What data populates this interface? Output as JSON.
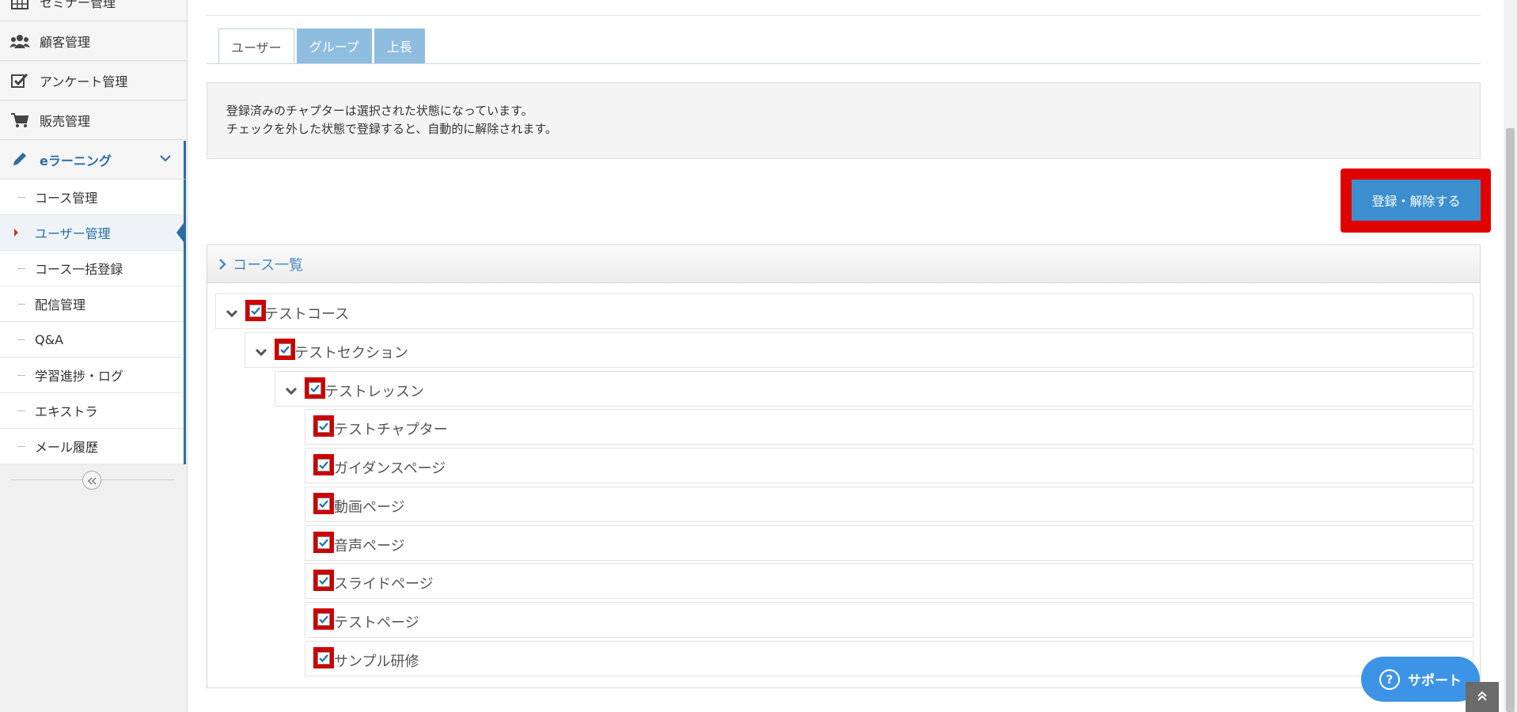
{
  "sidebar": {
    "items": [
      {
        "label": "セミナー管理",
        "icon": "calendar-grid-icon"
      },
      {
        "label": "顧客管理",
        "icon": "users-icon"
      },
      {
        "label": "アンケート管理",
        "icon": "checkbox-icon"
      },
      {
        "label": "販売管理",
        "icon": "cart-icon"
      },
      {
        "label": "eラーニング",
        "icon": "pencil-icon"
      }
    ],
    "submenu": [
      {
        "label": "コース管理"
      },
      {
        "label": "ユーザー管理"
      },
      {
        "label": "コース一括登録"
      },
      {
        "label": "配信管理"
      },
      {
        "label": "Q&A"
      },
      {
        "label": "学習進捗・ログ"
      },
      {
        "label": "エキストラ"
      },
      {
        "label": "メール履歴"
      }
    ]
  },
  "tabs": [
    {
      "label": "ユーザー"
    },
    {
      "label": "グループ"
    },
    {
      "label": "上長"
    }
  ],
  "info": {
    "line1": "登録済みのチャプターは選択された状態になっています。",
    "line2": "チェックを外した状態で登録すると、自動的に解除されます。"
  },
  "actions": {
    "register_label": "登録・解除する"
  },
  "panel": {
    "title": "コース一覧"
  },
  "tree": [
    {
      "label": "テストコース",
      "checked": true
    },
    {
      "label": "テストセクション",
      "checked": true
    },
    {
      "label": "テストレッスン",
      "checked": true
    },
    {
      "label": "テストチャプター",
      "checked": true
    },
    {
      "label": "ガイダンスページ",
      "checked": true
    },
    {
      "label": "動画ページ",
      "checked": true
    },
    {
      "label": "音声ページ",
      "checked": true
    },
    {
      "label": "スライドページ",
      "checked": true
    },
    {
      "label": "テストページ",
      "checked": true
    },
    {
      "label": "サンプル研修",
      "checked": true
    }
  ],
  "support": {
    "label": "サポート",
    "icon": "question-icon"
  },
  "colors": {
    "accent": "#3b8fce",
    "highlight": "#e00000",
    "tab_inactive": "#8fbde0",
    "support": "#3d94e6"
  }
}
